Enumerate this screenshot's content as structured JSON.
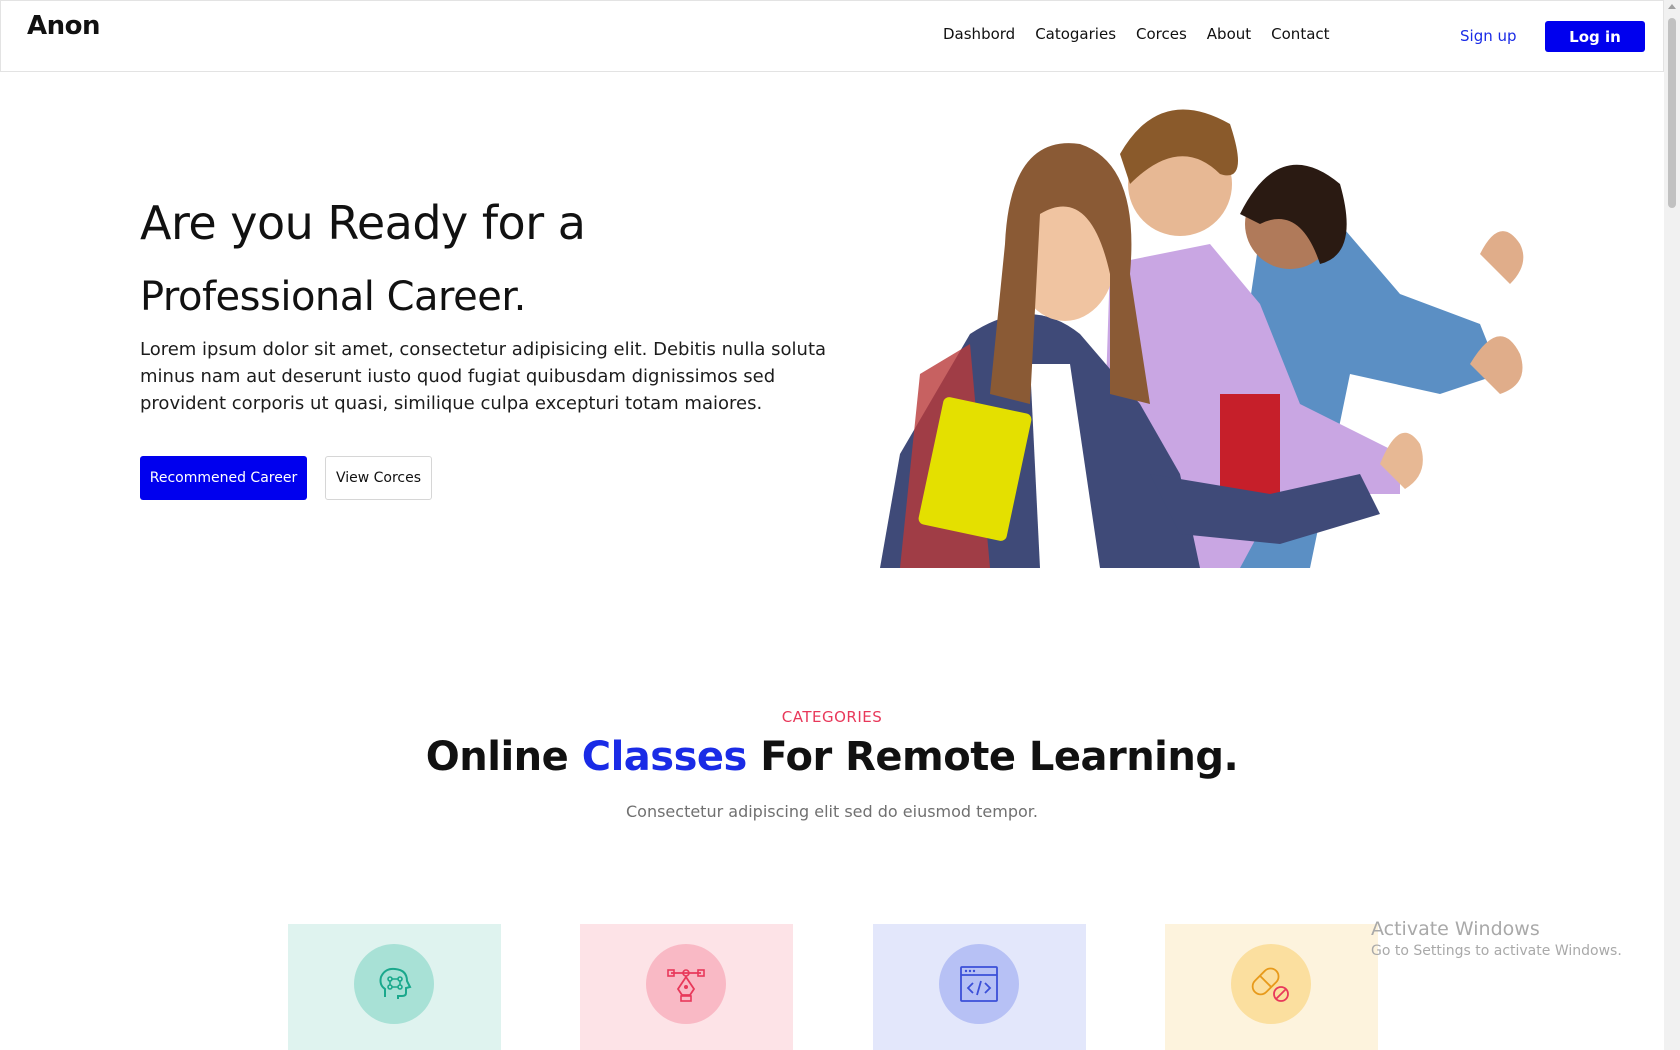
{
  "header": {
    "logo": "Anon",
    "nav": [
      "Dashbord",
      "Catogaries",
      "Corces",
      "About",
      "Contact"
    ],
    "signup": "Sign up",
    "login": "Log in"
  },
  "hero": {
    "title_line1": "Are you Ready for a",
    "title_line2": "Professional Career.",
    "description": "Lorem ipsum dolor sit amet, consectetur adipisicing elit. Debitis nulla soluta minus nam aut deserunt iusto quod fugiat quibusdam dignissimos sed provident corporis ut quasi, similique culpa excepturi totam maiores.",
    "primary_button": "Recommened Career",
    "secondary_button": "View Corces"
  },
  "categories": {
    "label": "CATEGORIES",
    "title_before": "Online ",
    "title_accent": "Classes",
    "title_after": " For Remote Learning.",
    "subtitle": "Consectetur adipiscing elit sed do eiusmod tempor.",
    "cards": [
      {
        "icon": "brain-head-icon",
        "color": "#1aa88c"
      },
      {
        "icon": "pen-tool-icon",
        "color": "#e8385a"
      },
      {
        "icon": "code-window-icon",
        "color": "#3b4fd8"
      },
      {
        "icon": "pill-icon",
        "color": "#e79a1b"
      }
    ]
  },
  "watermark": {
    "title": "Activate Windows",
    "subtitle": "Go to Settings to activate Windows."
  },
  "colors": {
    "primary": "#0000ee",
    "accent_blue": "#1a2be6",
    "accent_red": "#e8385a"
  }
}
